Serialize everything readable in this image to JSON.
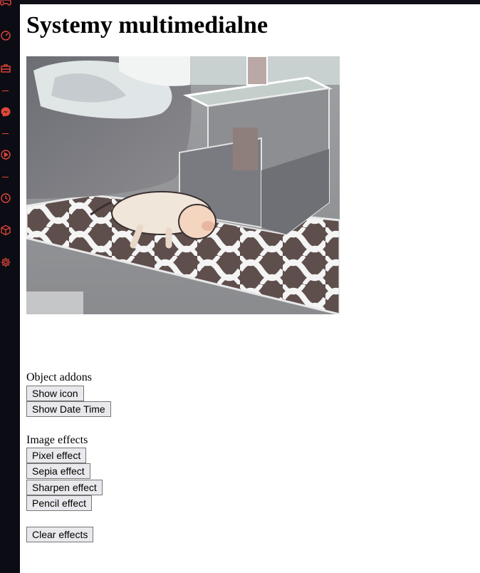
{
  "page": {
    "title": "Systemy multimedialne"
  },
  "sidebar": {
    "accent_color": "#e0473a",
    "background_color": "#0c0c14",
    "icons": [
      "gamepad-icon",
      "speedometer-icon",
      "briefcase-icon",
      "messenger-icon",
      "play-icon",
      "clock-icon",
      "cube-icon",
      "gear-icon"
    ]
  },
  "camera": {
    "description_icon": "webcam-feed"
  },
  "object_addons": {
    "label": "Object addons",
    "buttons": [
      "Show icon",
      "Show Date Time"
    ]
  },
  "image_effects": {
    "label": "Image effects",
    "buttons": [
      "Pixel effect",
      "Sepia effect",
      "Sharpen effect",
      "Pencil effect"
    ]
  },
  "clear": {
    "label": "Clear effects"
  }
}
